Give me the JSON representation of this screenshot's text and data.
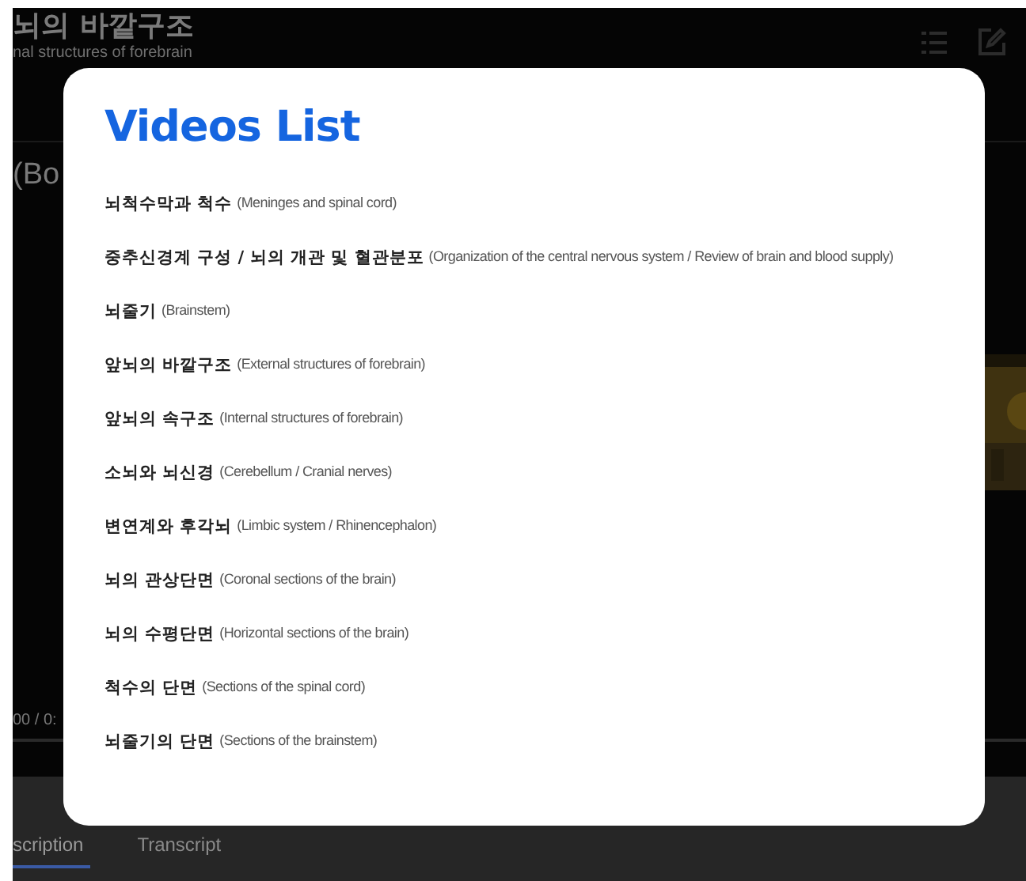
{
  "page": {
    "title": "뇌의 바깥구조",
    "subtitle": "nal structures of forebrain",
    "video_caption": "(Bo",
    "time": "00 / 0:",
    "tabs": [
      {
        "label": "scription",
        "selected": true
      },
      {
        "label": "Transcript",
        "selected": false
      }
    ]
  },
  "modal": {
    "title": "Videos List",
    "items": [
      {
        "title": "뇌척수막과 척수",
        "subtitle": "(Meninges and spinal cord)"
      },
      {
        "title": "중추신경계 구성 / 뇌의 개관 및 혈관분포",
        "subtitle": "(Organization of the central nervous system / Review of brain and blood supply)"
      },
      {
        "title": "뇌줄기",
        "subtitle": "(Brainstem)"
      },
      {
        "title": "앞뇌의 바깥구조",
        "subtitle": "(External structures of forebrain)"
      },
      {
        "title": "앞뇌의 속구조",
        "subtitle": "(Internal structures of forebrain)"
      },
      {
        "title": "소뇌와 뇌신경",
        "subtitle": "(Cerebellum / Cranial nerves)"
      },
      {
        "title": "변연계와 후각뇌",
        "subtitle": "(Limbic system / Rhinencephalon)"
      },
      {
        "title": "뇌의 관상단면",
        "subtitle": "(Coronal sections of the brain)"
      },
      {
        "title": "뇌의 수평단면",
        "subtitle": "(Horizontal sections of the brain)"
      },
      {
        "title": "척수의 단면",
        "subtitle": "(Sections of the spinal cord)"
      },
      {
        "title": "뇌줄기의 단면",
        "subtitle": "(Sections of the brainstem)"
      }
    ]
  }
}
